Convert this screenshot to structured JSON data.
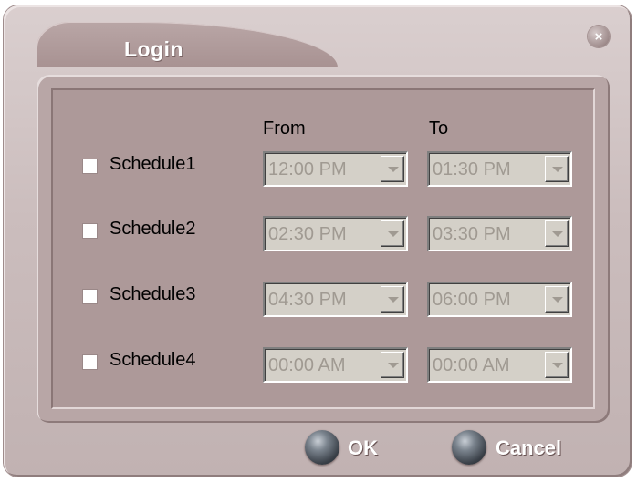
{
  "dialog": {
    "title": "Login",
    "close_glyph": "×",
    "close_icon": "close-icon"
  },
  "columns": {
    "from": "From",
    "to": "To"
  },
  "schedules": [
    {
      "label": "Schedule1",
      "checked": false,
      "from": "12:00 PM",
      "to": "01:30 PM"
    },
    {
      "label": "Schedule2",
      "checked": false,
      "from": "02:30 PM",
      "to": "03:30 PM"
    },
    {
      "label": "Schedule3",
      "checked": false,
      "from": "04:30 PM",
      "to": "06:00 PM"
    },
    {
      "label": "Schedule4",
      "checked": false,
      "from": "00:00 AM",
      "to": "00:00 AM"
    }
  ],
  "buttons": {
    "ok": "OK",
    "cancel": "Cancel"
  },
  "colors": {
    "dialog_bg": "#cbbdbd",
    "panel_bg": "#ad9999",
    "disabled_text": "#a09a92"
  }
}
